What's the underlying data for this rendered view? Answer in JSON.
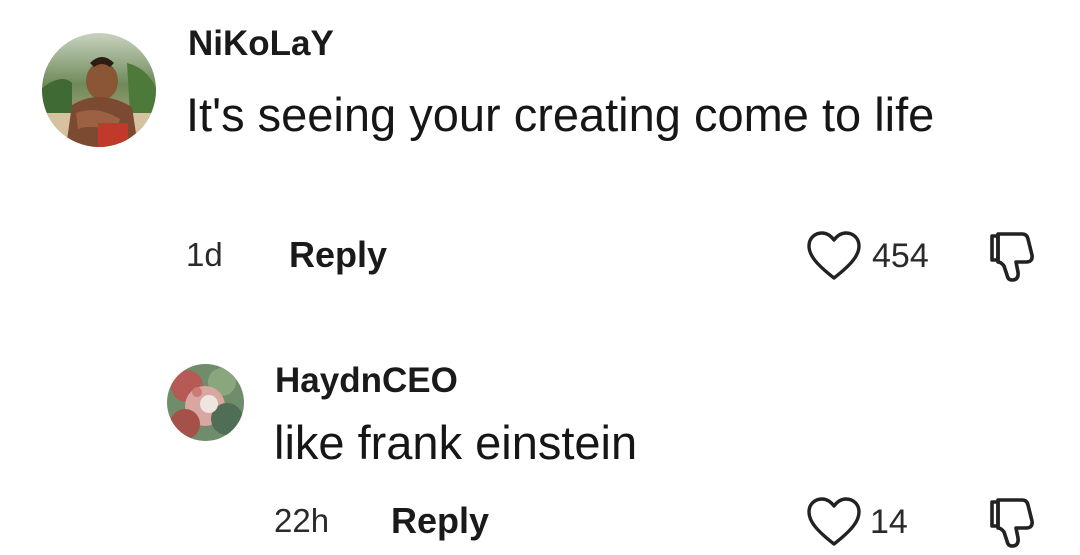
{
  "comments": [
    {
      "username": "NiKoLaY",
      "text": "It's seeing your creating come to life",
      "time": "1d",
      "reply_label": "Reply",
      "likes": "454"
    },
    {
      "username": "HaydnCEO",
      "text": "like frank einstein",
      "time": "22h",
      "reply_label": "Reply",
      "likes": "14"
    }
  ],
  "icons": {
    "like": "heart-outline-icon",
    "dislike": "thumbs-down-outline-icon"
  },
  "colors": {
    "text": "#161616",
    "muted": "#2a2a2a",
    "background": "#ffffff"
  }
}
